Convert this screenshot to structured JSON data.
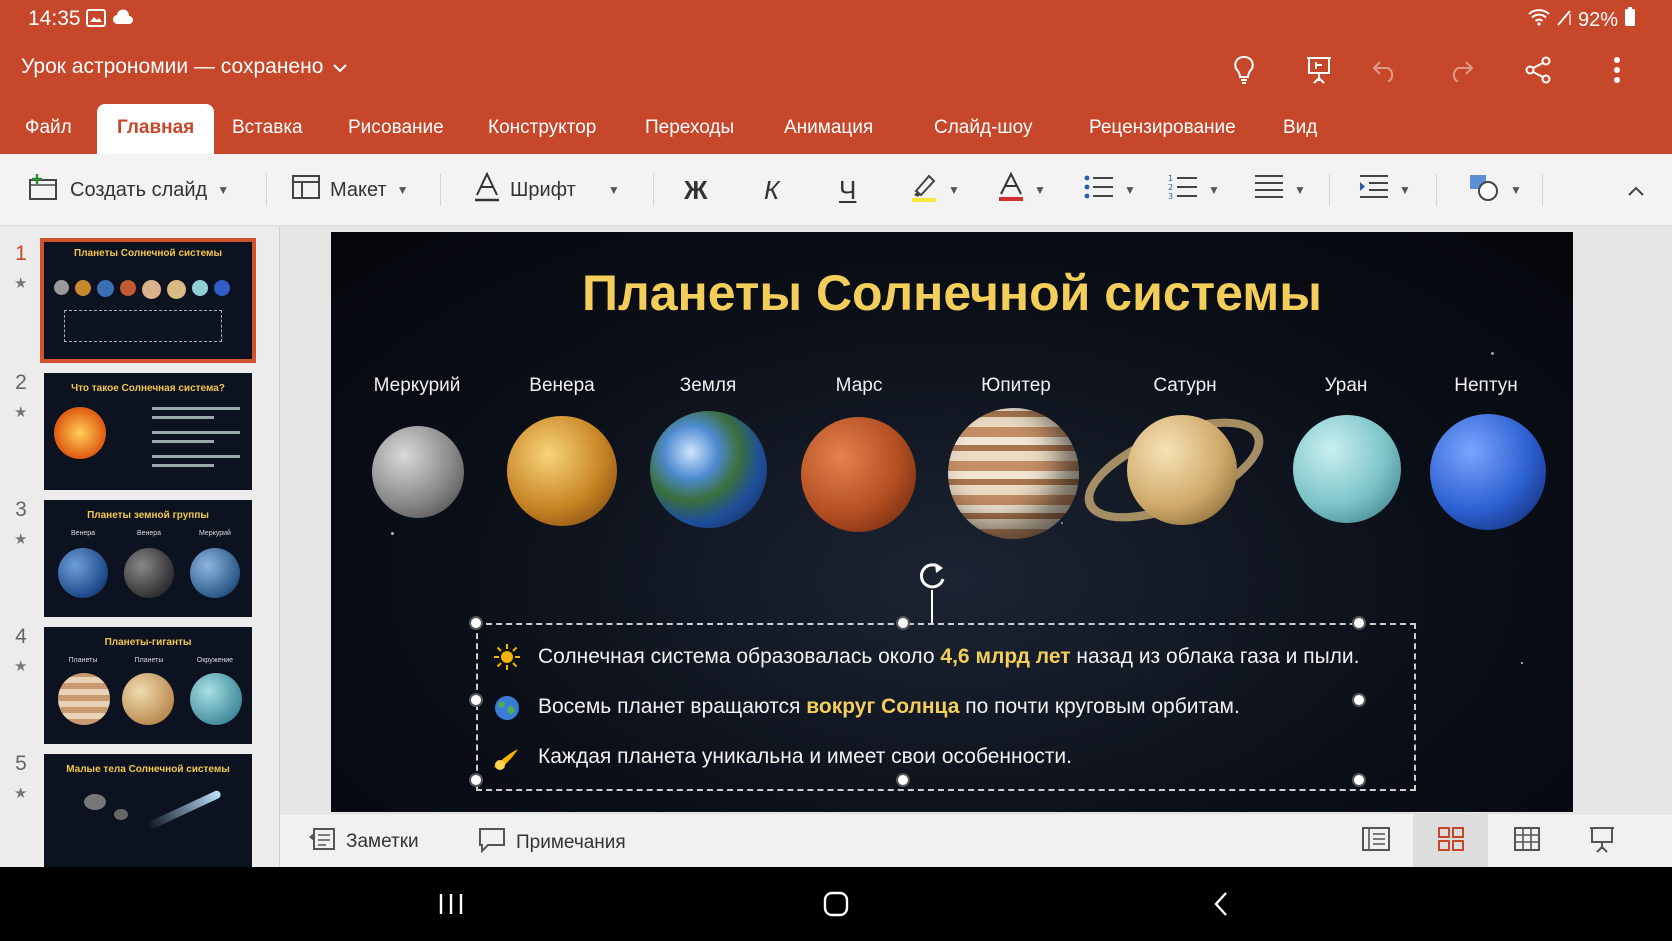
{
  "status": {
    "time": "14:35",
    "battery": "92%"
  },
  "title": {
    "doc_name": "Урок астрономии — сохранено"
  },
  "tabs": [
    "Файл",
    "Главная",
    "Вставка",
    "Рисование",
    "Конструктор",
    "Переходы",
    "Анимация",
    "Слайд-шоу",
    "Рецензирование",
    "Вид"
  ],
  "active_tab": "Главная",
  "ribbon": {
    "new_slide": "Создать слайд",
    "layout": "Макет",
    "font": "Шрифт",
    "bold": "Ж",
    "italic": "К",
    "underline": "Ч"
  },
  "thumbnails": [
    {
      "num": "1",
      "title": "Планеты Солнечной системы"
    },
    {
      "num": "2",
      "title": "Что такое Солнечная система?"
    },
    {
      "num": "3",
      "title": "Планеты земной группы",
      "captions": [
        "Венера",
        "Венера",
        "Меркурий"
      ]
    },
    {
      "num": "4",
      "title": "Планеты-гиганты",
      "captions": [
        "Планеты",
        "Планеты",
        "Окружение"
      ]
    },
    {
      "num": "5",
      "title": "Малые тела Солнечной системы"
    }
  ],
  "slide": {
    "title": "Планеты Солнечной системы",
    "planets": [
      "Меркурий",
      "Венера",
      "Земля",
      "Марс",
      "Юпитер",
      "Сатурн",
      "Уран",
      "Нептун"
    ],
    "bullets": [
      {
        "pre": "Солнечная система образовалась около ",
        "hl": "4,6 млрд лет",
        "post": " назад из облака газа и пыли."
      },
      {
        "pre": "Восемь планет вращаются ",
        "hl": "вокруг Солнца",
        "post": " по почти круговым орбитам."
      },
      {
        "pre": "Каждая планета уникальна и имеет свои особенности.",
        "hl": "",
        "post": ""
      }
    ]
  },
  "bottom": {
    "notes": "Заметки",
    "comments": "Примечания"
  },
  "colors": {
    "accent": "#C7472B",
    "title_gold": "#F4CE5A"
  },
  "icons": [
    "lightbulb-icon",
    "present-icon",
    "undo-icon",
    "redo-icon",
    "share-icon",
    "more-icon"
  ]
}
